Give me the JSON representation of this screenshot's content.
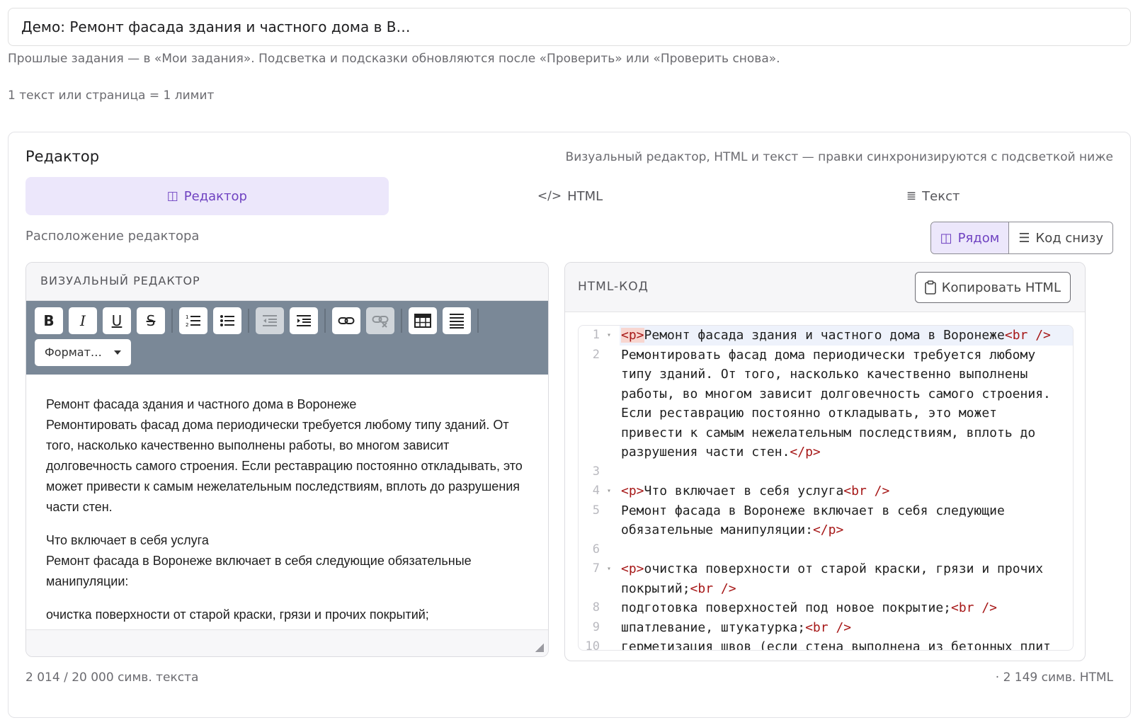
{
  "title_field": {
    "value": "Демо: Ремонт фасада здания и частного дома в В…"
  },
  "hint": "Прошлые задания — в «Мои задания». Подсветка и подсказки обновляются после «Проверить» или «Проверить снова».",
  "limit_note": "1 текст или страница = 1 лимит",
  "panel": {
    "title": "Редактор",
    "subtitle": "Визуальный редактор, HTML и текст — правки синхронизируются с подсветкой ниже",
    "tabs": [
      {
        "icon": "book-icon",
        "glyph": "◫",
        "label": "Редактор",
        "active": true
      },
      {
        "icon": "code-icon",
        "glyph": "</>",
        "label": "HTML",
        "active": false
      },
      {
        "icon": "lines-icon",
        "glyph": "≣",
        "label": "Текст",
        "active": false
      }
    ],
    "layout_label": "Расположение редактора",
    "layout_options": [
      {
        "icon": "columns-icon",
        "glyph": "◫",
        "label": "Рядом",
        "active": true
      },
      {
        "icon": "code-below-icon",
        "glyph": "☰",
        "label": "Код снизу",
        "active": false
      }
    ]
  },
  "visual_editor": {
    "header": "ВИЗУАЛЬНЫЙ РЕДАКТОР",
    "format_select": "Формат…",
    "paragraphs": [
      [
        "Ремонт фасада здания и частного дома в Воронеже",
        "Ремонтировать фасад дома периодически требуется любому типу зданий. От того, насколько качественно выполнены работы, во многом зависит долговечность самого строения. Если реставрацию постоянно откладывать, это может привести к самым нежелательным последствиям, вплоть до разрушения части стен."
      ],
      [
        "Что включает в себя услуга",
        "Ремонт фасада в Воронеже включает в себя следующие обязательные манипуляции:"
      ],
      [
        "очистка поверхности от старой краски, грязи и прочих покрытий;"
      ]
    ]
  },
  "html_editor": {
    "header": "HTML-КОД",
    "copy_button": "Копировать HTML",
    "lines": [
      {
        "n": "1",
        "fold": true,
        "parts": [
          {
            "t": "<p>",
            "tag": true,
            "cursor": true
          },
          {
            "t": "Ремонт фасада здания и частного дома в Воронеже"
          },
          {
            "t": "<br />",
            "tag": true
          }
        ]
      },
      {
        "n": "2",
        "fold": false,
        "parts": [
          {
            "t": "Ремонтировать фасад дома периодически требуется любому типу зданий. От того, насколько качественно выполнены работы, во многом зависит долговечность самого строения. Если реставрацию постоянно откладывать, это может привести к самым нежелательным последствиям, вплоть до разрушения части стен."
          },
          {
            "t": "</p>",
            "tag": true
          }
        ]
      },
      {
        "n": "3",
        "fold": false,
        "parts": []
      },
      {
        "n": "4",
        "fold": true,
        "parts": [
          {
            "t": "<p>",
            "tag": true
          },
          {
            "t": "Что включает в себя услуга"
          },
          {
            "t": "<br />",
            "tag": true
          }
        ]
      },
      {
        "n": "5",
        "fold": false,
        "parts": [
          {
            "t": "Ремонт фасада в Воронеже включает в себя следующие обязательные манипуляции:"
          },
          {
            "t": "</p>",
            "tag": true
          }
        ]
      },
      {
        "n": "6",
        "fold": false,
        "parts": []
      },
      {
        "n": "7",
        "fold": true,
        "parts": [
          {
            "t": "<p>",
            "tag": true
          },
          {
            "t": "очистка поверхности от старой краски, грязи и прочих покрытий;"
          },
          {
            "t": "<br />",
            "tag": true
          }
        ]
      },
      {
        "n": "8",
        "fold": false,
        "parts": [
          {
            "t": "подготовка поверхностей под новое покрытие;"
          },
          {
            "t": "<br />",
            "tag": true
          }
        ]
      },
      {
        "n": "9",
        "fold": false,
        "parts": [
          {
            "t": "шпатлевание, штукатурка;"
          },
          {
            "t": "<br />",
            "tag": true
          }
        ]
      },
      {
        "n": "10",
        "fold": false,
        "parts": [
          {
            "t": "герметизация швов (если стена выполнена из бетонных плит"
          }
        ]
      }
    ]
  },
  "counters": {
    "text_chars": "2 014 / 20 000 симв. текста",
    "html_chars": "· 2 149 симв. HTML"
  },
  "colors": {
    "accent": "#6f42c1",
    "accent_bg": "#ece7fb",
    "toolbar_bg": "#7a8897",
    "tag": "#a61717"
  }
}
